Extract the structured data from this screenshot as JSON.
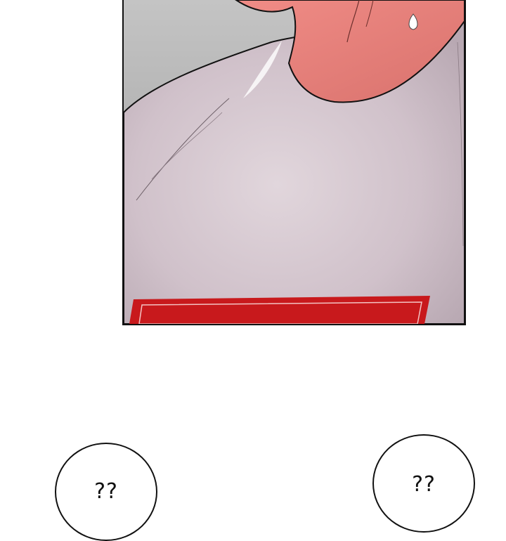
{
  "panel": {
    "description_colors": {
      "background_gray": "#a9a9a9",
      "shirt": "#d2c3cc",
      "skin": "#e3837c",
      "emblem_red": "#c8191c"
    }
  },
  "bubbles": {
    "left": {
      "text": "??"
    },
    "right": {
      "text": "??"
    }
  }
}
